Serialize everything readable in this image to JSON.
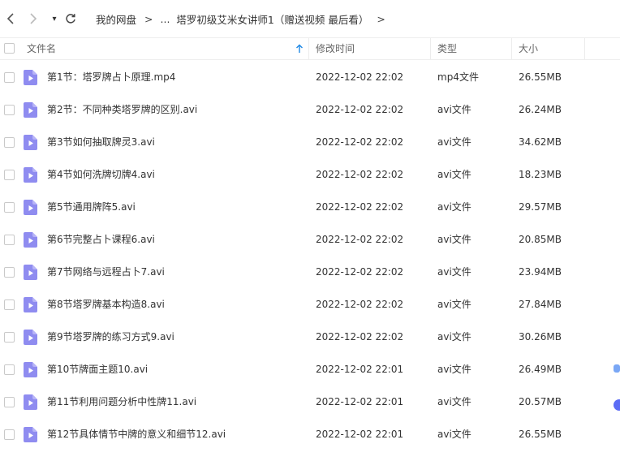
{
  "nav": {
    "dropdown_glyph": "▾"
  },
  "breadcrumb": {
    "root": "我的网盘",
    "sep": ">",
    "ellipsis": "...",
    "current": "塔罗初级艾米女讲师1（赠送视频 最后看）"
  },
  "columns": {
    "name": "文件名",
    "modified": "修改时间",
    "type": "类型",
    "size": "大小"
  },
  "colors": {
    "accent": "#1e88e5",
    "file_icon": "#8f8cf0",
    "side_dot": "#5b6cf5"
  },
  "files": [
    {
      "name": "第1节：塔罗牌占卜原理.mp4",
      "modified": "2022-12-02 22:02",
      "type": "mp4文件",
      "size": "26.55MB",
      "icon": "video-file-icon"
    },
    {
      "name": "第2节：不同种类塔罗牌的区别.avi",
      "modified": "2022-12-02 22:02",
      "type": "avi文件",
      "size": "26.24MB",
      "icon": "video-file-icon"
    },
    {
      "name": "第3节如何抽取牌灵3.avi",
      "modified": "2022-12-02 22:02",
      "type": "avi文件",
      "size": "34.62MB",
      "icon": "video-file-icon"
    },
    {
      "name": "第4节如何洗牌切牌4.avi",
      "modified": "2022-12-02 22:02",
      "type": "avi文件",
      "size": "18.23MB",
      "icon": "video-file-icon"
    },
    {
      "name": "第5节通用牌阵5.avi",
      "modified": "2022-12-02 22:02",
      "type": "avi文件",
      "size": "29.57MB",
      "icon": "video-file-icon"
    },
    {
      "name": "第6节完整占卜课程6.avi",
      "modified": "2022-12-02 22:02",
      "type": "avi文件",
      "size": "20.85MB",
      "icon": "video-file-icon"
    },
    {
      "name": "第7节网络与远程占卜7.avi",
      "modified": "2022-12-02 22:02",
      "type": "avi文件",
      "size": "23.94MB",
      "icon": "video-file-icon"
    },
    {
      "name": "第8节塔罗牌基本构造8.avi",
      "modified": "2022-12-02 22:02",
      "type": "avi文件",
      "size": "27.84MB",
      "icon": "video-file-icon"
    },
    {
      "name": "第9节塔罗牌的练习方式9.avi",
      "modified": "2022-12-02 22:02",
      "type": "avi文件",
      "size": "30.26MB",
      "icon": "video-file-icon"
    },
    {
      "name": "第10节牌面主题10.avi",
      "modified": "2022-12-02 22:01",
      "type": "avi文件",
      "size": "26.49MB",
      "icon": "video-file-icon"
    },
    {
      "name": "第11节利用问题分析中性牌11.avi",
      "modified": "2022-12-02 22:01",
      "type": "avi文件",
      "size": "20.57MB",
      "icon": "video-file-icon"
    },
    {
      "name": "第12节具体情节中牌的意义和细节12.avi",
      "modified": "2022-12-02 22:01",
      "type": "avi文件",
      "size": "26.55MB",
      "icon": "video-file-icon"
    }
  ]
}
